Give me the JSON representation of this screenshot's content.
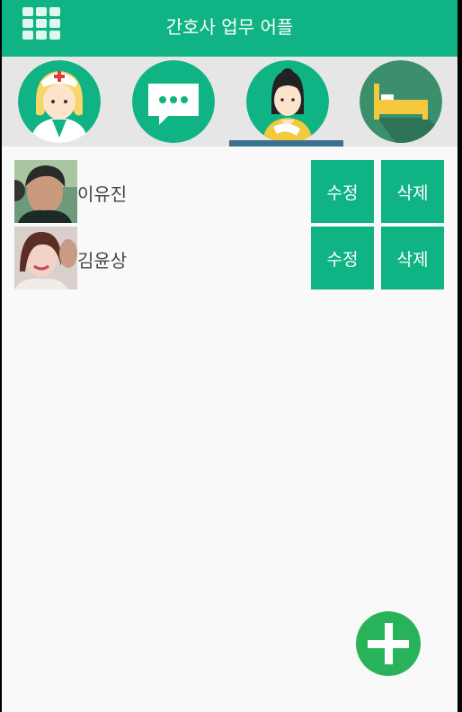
{
  "app": {
    "title": "간호사 업무 어플",
    "colors": {
      "primary": "#10b383",
      "indicator": "#3d6f8f",
      "fab": "#28b35a",
      "background": "#f9f9f9"
    }
  },
  "menu": {
    "icon": "grid-menu-icon"
  },
  "tabs": [
    {
      "icon": "nurse-icon",
      "selected": false
    },
    {
      "icon": "chat-bubble-icon",
      "selected": false
    },
    {
      "icon": "patient-icon",
      "selected": true
    },
    {
      "icon": "hospital-bed-icon",
      "selected": false
    }
  ],
  "patients": [
    {
      "name": "이유진",
      "edit_label": "수정",
      "delete_label": "삭제"
    },
    {
      "name": "김윤상",
      "edit_label": "수정",
      "delete_label": "삭제"
    }
  ],
  "fab": {
    "icon": "plus-icon"
  }
}
